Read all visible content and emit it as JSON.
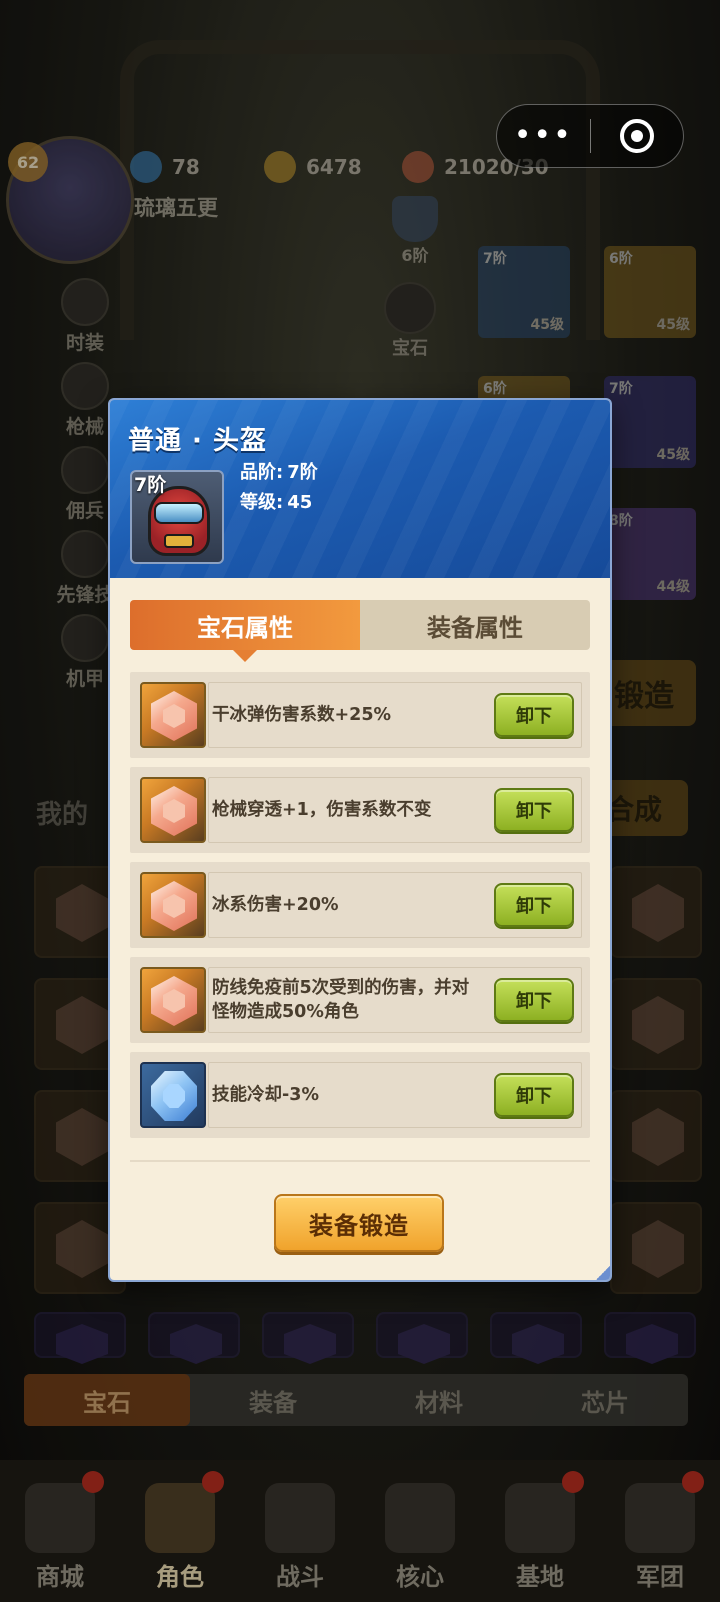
{
  "capsule": {
    "more_label": "•••"
  },
  "player": {
    "level": "62",
    "name": "琉璃五更",
    "resources": [
      {
        "icon": "gem-currency-icon",
        "value": "78",
        "color": "#3b7fb7"
      },
      {
        "icon": "gold-coin-icon",
        "value": "6478",
        "color": "#b8902e"
      },
      {
        "icon": "meat-stamina-icon",
        "value": "21020/30",
        "color": "#b55a3e"
      }
    ]
  },
  "side_menu": [
    "时装",
    "枪械",
    "佣兵",
    "先锋技",
    "机甲"
  ],
  "rank_mini": {
    "label": "6阶"
  },
  "gem_mini": {
    "label": "宝石"
  },
  "equip_slots": [
    {
      "tier": "7阶",
      "level": "45级",
      "color": "#2c4e78"
    },
    {
      "tier": "6阶",
      "level": "45级",
      "color": "#8a6a20"
    },
    {
      "tier": "6阶",
      "level": "",
      "color": "#8a6a20"
    },
    {
      "tier": "7阶",
      "level": "45级",
      "color": "#3a3580"
    },
    {
      "tier": "",
      "level": "",
      "color": "#3a2e6b"
    },
    {
      "tier": "8阶",
      "level": "44级",
      "color": "#5a3e8c"
    }
  ],
  "bg_buttons": {
    "forge": "锻造",
    "synthesize": "合成",
    "my": "我的"
  },
  "bottom_tabs": [
    {
      "label": "宝石",
      "active": true
    },
    {
      "label": "装备",
      "active": false
    },
    {
      "label": "材料",
      "active": false
    },
    {
      "label": "芯片",
      "active": false
    }
  ],
  "nav": [
    {
      "label": "商城",
      "icon": "shop-icon",
      "dot": true,
      "active": false
    },
    {
      "label": "角色",
      "icon": "character-icon",
      "dot": true,
      "active": true
    },
    {
      "label": "战斗",
      "icon": "battle-icon",
      "dot": false,
      "active": false
    },
    {
      "label": "核心",
      "icon": "core-icon",
      "dot": false,
      "active": false
    },
    {
      "label": "基地",
      "icon": "base-icon",
      "dot": true,
      "active": false
    },
    {
      "label": "军团",
      "icon": "legion-icon",
      "dot": true,
      "active": false
    }
  ],
  "modal": {
    "title": "普通 · 头盔",
    "equip": {
      "tier_tag": "7阶",
      "quality_label": "品阶:",
      "quality_value": "7阶",
      "level_label": "等级:",
      "level_value": "45"
    },
    "tabs": {
      "gem_attrs": "宝石属性",
      "equip_attrs": "装备属性"
    },
    "gems": [
      {
        "type": "orange",
        "text": "干冰弹伤害系数+25%",
        "button": "卸下"
      },
      {
        "type": "orange",
        "text": "枪械穿透+1，伤害系数不变",
        "button": "卸下"
      },
      {
        "type": "orange",
        "text": "冰系伤害+20%",
        "button": "卸下"
      },
      {
        "type": "orange",
        "text": "防线免疫前5次受到的伤害，并对怪物造成50%角色",
        "button": "卸下"
      },
      {
        "type": "blue",
        "text": "技能冷却-3%",
        "button": "卸下"
      }
    ],
    "forge_button": "装备锻造"
  }
}
